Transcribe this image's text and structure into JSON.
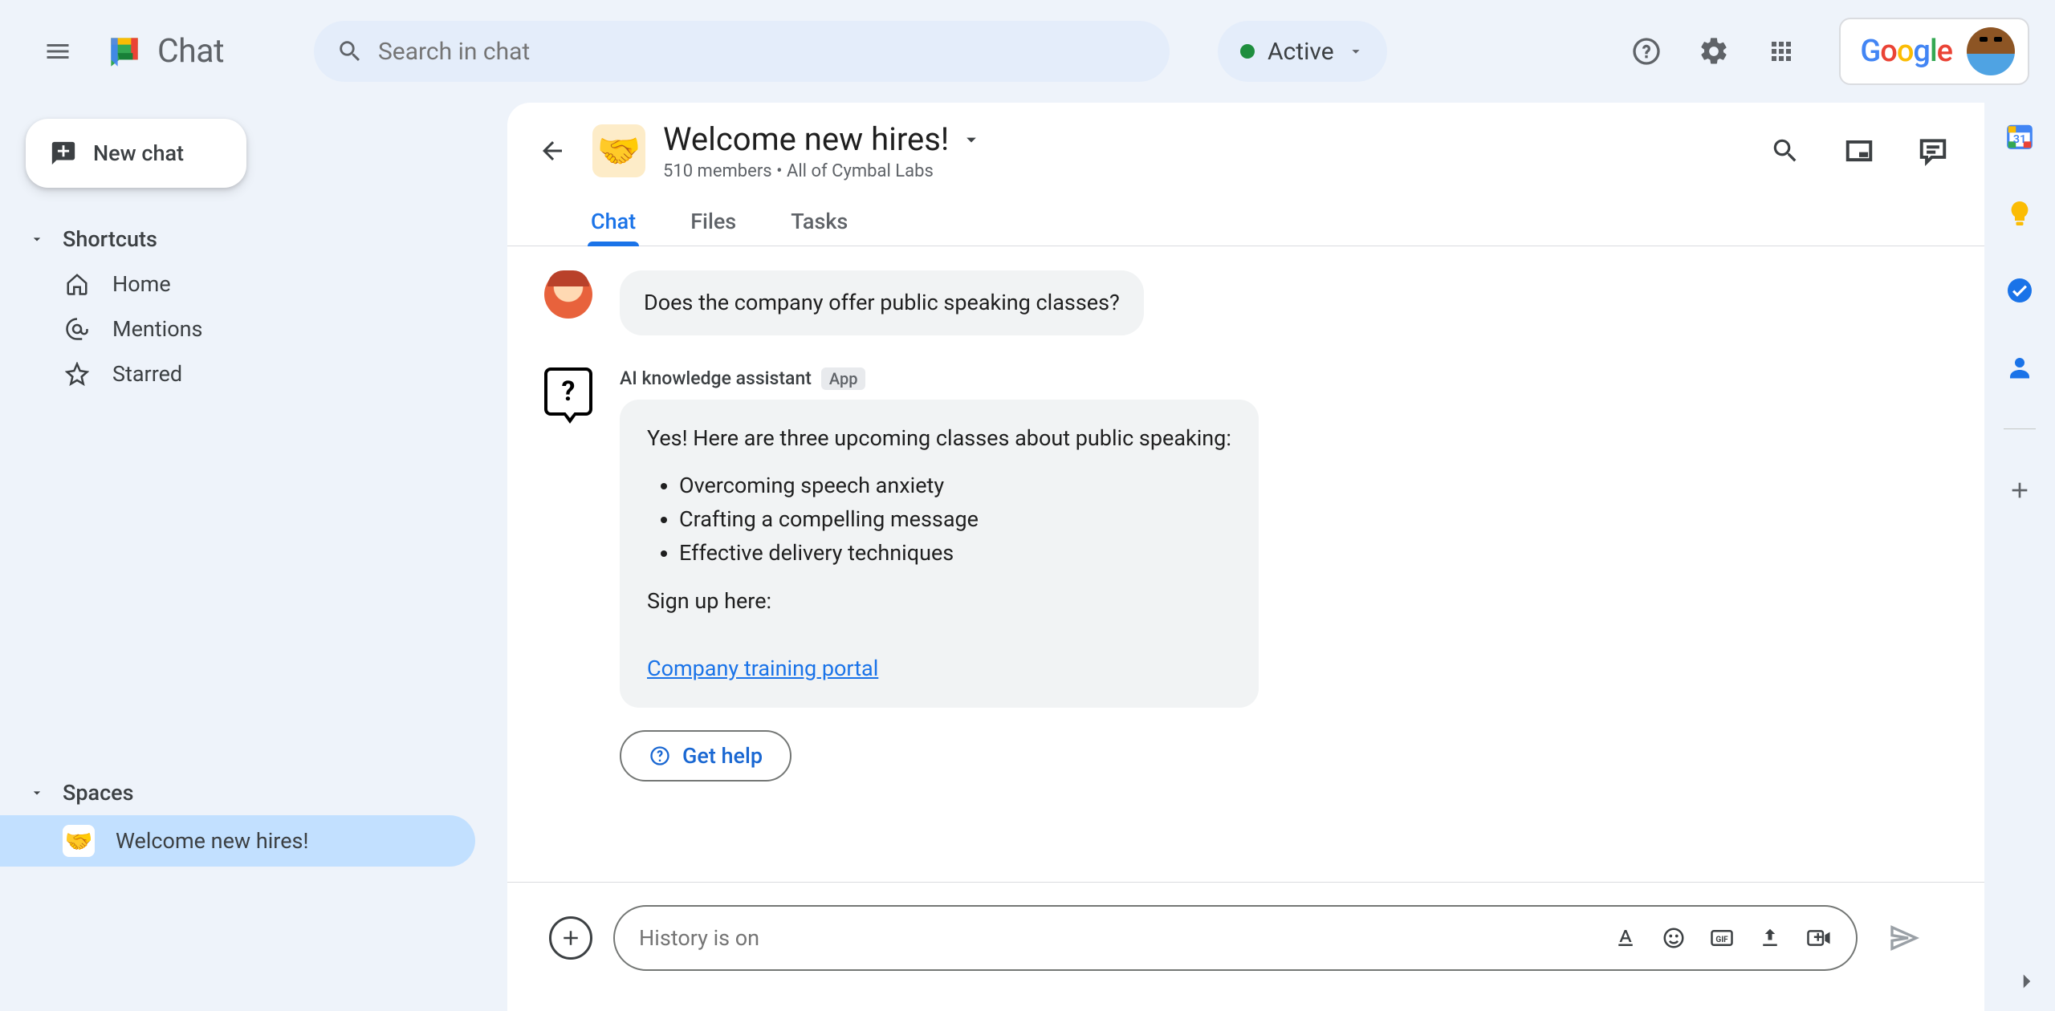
{
  "brand": {
    "name": "Chat"
  },
  "search": {
    "placeholder": "Search in chat"
  },
  "status": {
    "label": "Active"
  },
  "sidebar": {
    "new_chat": "New chat",
    "shortcuts_label": "Shortcuts",
    "home": "Home",
    "mentions": "Mentions",
    "starred": "Starred",
    "spaces_label": "Spaces",
    "space_name": "Welcome new hires!"
  },
  "room": {
    "title": "Welcome new hires!",
    "subtitle": "510 members  •  All of Cymbal Labs",
    "tabs": {
      "chat": "Chat",
      "files": "Files",
      "tasks": "Tasks"
    }
  },
  "messages": {
    "user_msg": "Does the company offer public speaking classes?",
    "bot_name": "AI knowledge assistant",
    "bot_badge": "App",
    "bot_intro": "Yes! Here are three upcoming classes about public speaking:",
    "bot_items": [
      "Overcoming speech anxiety",
      "Crafting a compelling message",
      "Effective delivery techniques"
    ],
    "bot_signup": "Sign up here:",
    "bot_link": "Company training portal",
    "get_help": "Get help"
  },
  "compose": {
    "placeholder": "History is on"
  }
}
